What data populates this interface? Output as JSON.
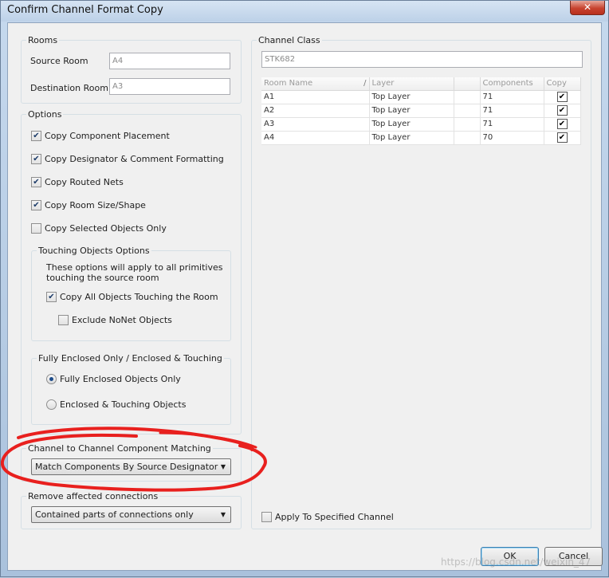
{
  "window": {
    "title": "Confirm Channel Format Copy",
    "close_glyph": "✕"
  },
  "rooms": {
    "legend": "Rooms",
    "source_label": "Source Room",
    "source_value": "A4",
    "dest_label": "Destination Room",
    "dest_value": "A3"
  },
  "options": {
    "legend": "Options",
    "items": [
      {
        "label": "Copy Component Placement",
        "checked": true
      },
      {
        "label": "Copy Designator & Comment Formatting",
        "checked": true
      },
      {
        "label": "Copy Routed Nets",
        "checked": true
      },
      {
        "label": "Copy Room Size/Shape",
        "checked": true
      },
      {
        "label": "Copy Selected Objects Only",
        "checked": false
      }
    ],
    "touching": {
      "legend": "Touching Objects Options",
      "note_line1": "These options will apply to all primitives",
      "note_line2": "touching the source room",
      "copy_all_label": "Copy All Objects Touching the Room",
      "copy_all_checked": true,
      "exclude_label": "Exclude NoNet Objects",
      "exclude_checked": false
    },
    "enclosed": {
      "legend": "Fully Enclosed Only / Enclosed & Touching",
      "fully_label": "Fully Enclosed Objects Only",
      "touching_label": "Enclosed & Touching Objects",
      "selected": "fully"
    }
  },
  "matching": {
    "legend": "Channel to Channel Component Matching",
    "selected": "Match Components By Source Designator"
  },
  "connections": {
    "legend": "Remove affected connections",
    "selected": "Contained parts of connections only"
  },
  "channel_class": {
    "legend": "Channel Class",
    "value": "STK682",
    "columns": [
      "Room Name",
      "Layer",
      "",
      "Components",
      "Copy"
    ],
    "rows": [
      {
        "room": "A1",
        "layer": "Top Layer",
        "components": "71",
        "copy": true
      },
      {
        "room": "A2",
        "layer": "Top Layer",
        "components": "71",
        "copy": true
      },
      {
        "room": "A3",
        "layer": "Top Layer",
        "components": "71",
        "copy": true
      },
      {
        "room": "A4",
        "layer": "Top Layer",
        "components": "70",
        "copy": true
      }
    ],
    "apply_label": "Apply To Specified Channel",
    "apply_checked": false
  },
  "buttons": {
    "ok": "OK",
    "cancel": "Cancel"
  },
  "watermark": "https://blog.csdn.net/weixin_47",
  "icons": {
    "check": "✔",
    "dropdown": "▼",
    "sort": "/"
  },
  "colors": {
    "annotation": "#e8201e",
    "close_button": "#c7432f"
  }
}
